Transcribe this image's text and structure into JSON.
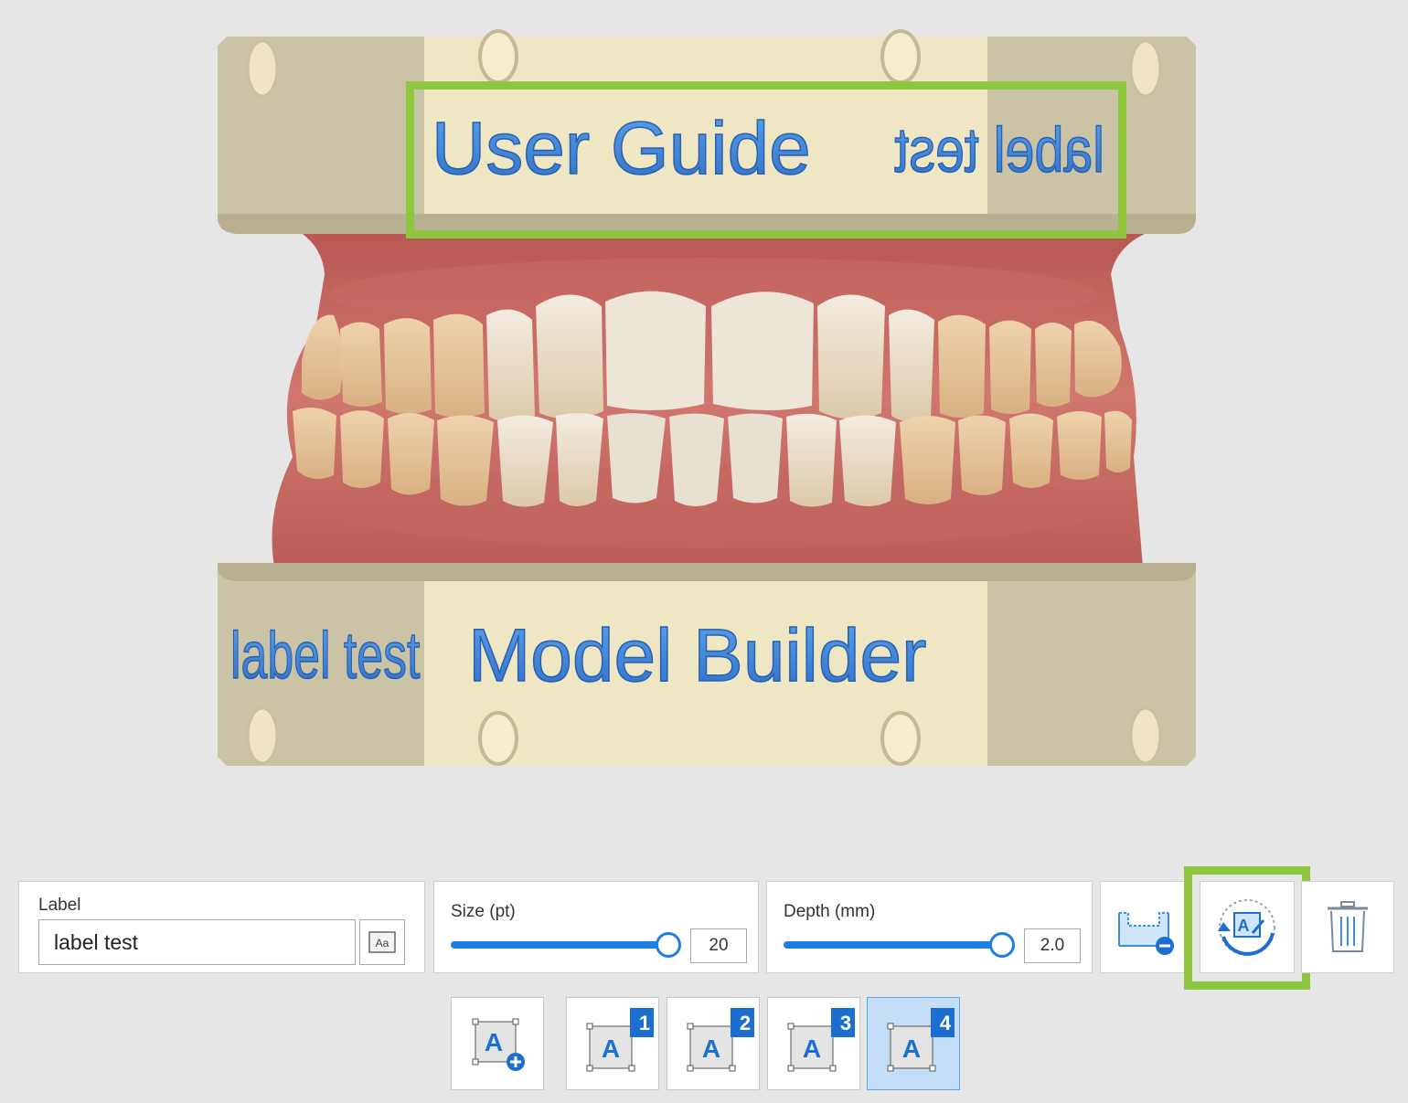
{
  "viewport": {
    "top_labels": {
      "main": "User Guide",
      "mirrored": "label test"
    },
    "bottom_labels": {
      "side": "label test",
      "main": "Model Builder"
    }
  },
  "label_panel": {
    "title": "Label",
    "input_value": "label test",
    "font_icon_text": "Aa"
  },
  "size_panel": {
    "title": "Size (pt)",
    "value": "20",
    "fraction": 0.96
  },
  "depth_panel": {
    "title": "Depth (mm)",
    "value": "2.0",
    "fraction": 0.96
  },
  "tools": [
    "emboss-deboss-icon",
    "flip-label-icon",
    "trash-icon"
  ],
  "label_slots": [
    {
      "badge": "",
      "icon_text": "A"
    },
    {
      "badge": "1",
      "icon_text": "A"
    },
    {
      "badge": "2",
      "icon_text": "A"
    },
    {
      "badge": "3",
      "icon_text": "A"
    },
    {
      "badge": "4",
      "icon_text": "A",
      "active": true
    }
  ],
  "colors": {
    "accent": "#1c7fe3",
    "highlight": "#8dc63f",
    "active_slot": "#c4def8"
  }
}
